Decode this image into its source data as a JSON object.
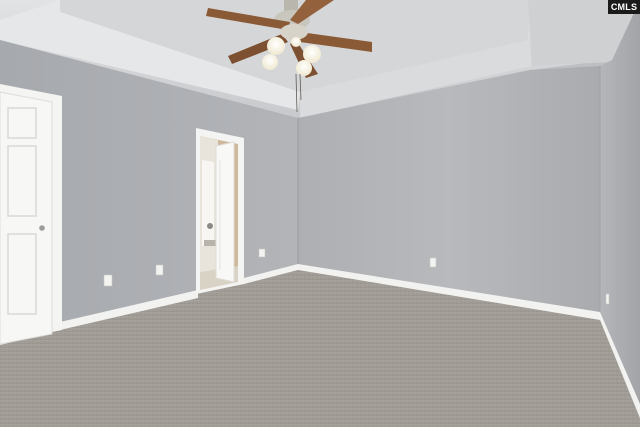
{
  "watermark": {
    "text": "CMLS"
  },
  "scene": {
    "description_tag": "empty-bedroom",
    "colors": {
      "wall": "#a9acb0",
      "ceiling": "#d8d9db",
      "carpet": "#a39e99",
      "trim": "#f4f4f2",
      "fan_blade": "#8a5a36",
      "light_globe": "#fbf7e8"
    }
  }
}
